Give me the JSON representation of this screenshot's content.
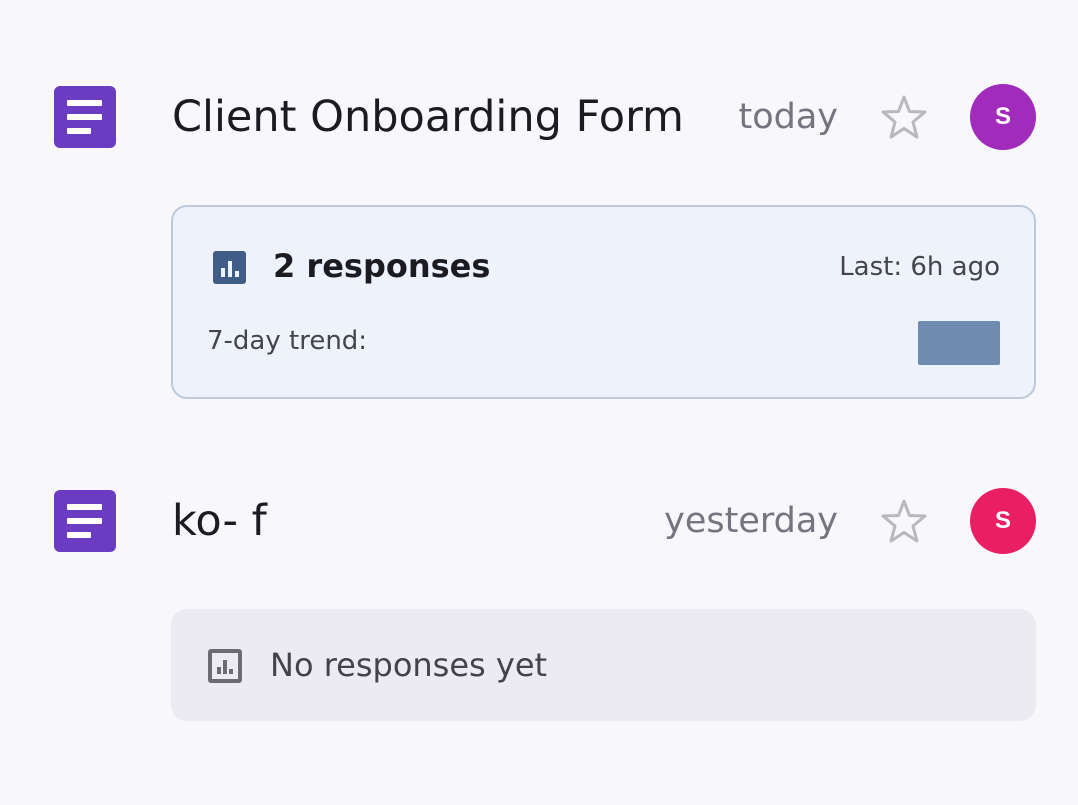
{
  "forms": [
    {
      "title": "Client Onboarding Form",
      "date": "today",
      "avatar_letter": "S",
      "avatar_color": "#a12bbb",
      "starred": false,
      "icon": "form-icon",
      "responses": {
        "count_label": "2 responses",
        "last_label": "Last: 6h ago",
        "trend_label": "7-day trend:"
      }
    },
    {
      "title": "ko- f",
      "date": "yesterday",
      "avatar_letter": "S",
      "avatar_color": "#e91e63",
      "starred": false,
      "icon": "form-icon",
      "responses": {
        "empty_label": "No responses yet"
      }
    }
  ],
  "colors": {
    "form_icon": "#6b3cc1",
    "card_bg": "#edf2fc",
    "card_border": "#bccadb",
    "trend_bar": "#6f8bb0",
    "empty_card_bg": "#ecebf2"
  }
}
